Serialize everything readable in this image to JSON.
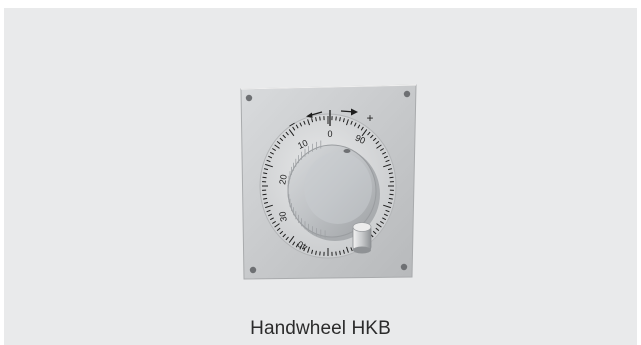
{
  "caption": "Handwheel HKB",
  "dial": {
    "numbers": [
      "0",
      "10",
      "20",
      "30",
      "40",
      "90"
    ],
    "markers": {
      "minus": "−",
      "plus": "+"
    }
  },
  "colors": {
    "background": "#e9eaeb",
    "plate": "#c9cbcd",
    "dial_face": "#d7d9db",
    "knob": "#c2c5c8",
    "marking": "#1d1d1d"
  }
}
